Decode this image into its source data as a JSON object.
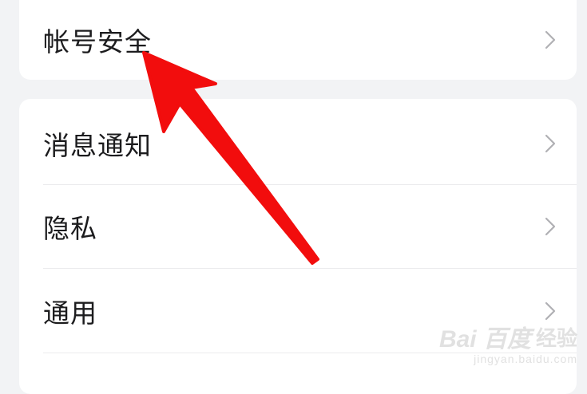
{
  "settings": {
    "group1": [
      {
        "label": "帐号安全",
        "icon": "chevron-right-icon"
      }
    ],
    "group2": [
      {
        "label": "消息通知",
        "icon": "chevron-right-icon"
      },
      {
        "label": "隐私",
        "icon": "chevron-right-icon"
      },
      {
        "label": "通用",
        "icon": "chevron-right-icon"
      }
    ]
  },
  "annotation": {
    "type": "arrow",
    "color": "#f20d0d"
  },
  "watermark": {
    "logo": "Bai  百度",
    "text": "经验",
    "url": "jingyan.baidu.com"
  },
  "colors": {
    "background": "#f2f3f5",
    "card": "#ffffff",
    "text": "#1c1c1e",
    "chevron": "#b0b0b4"
  }
}
